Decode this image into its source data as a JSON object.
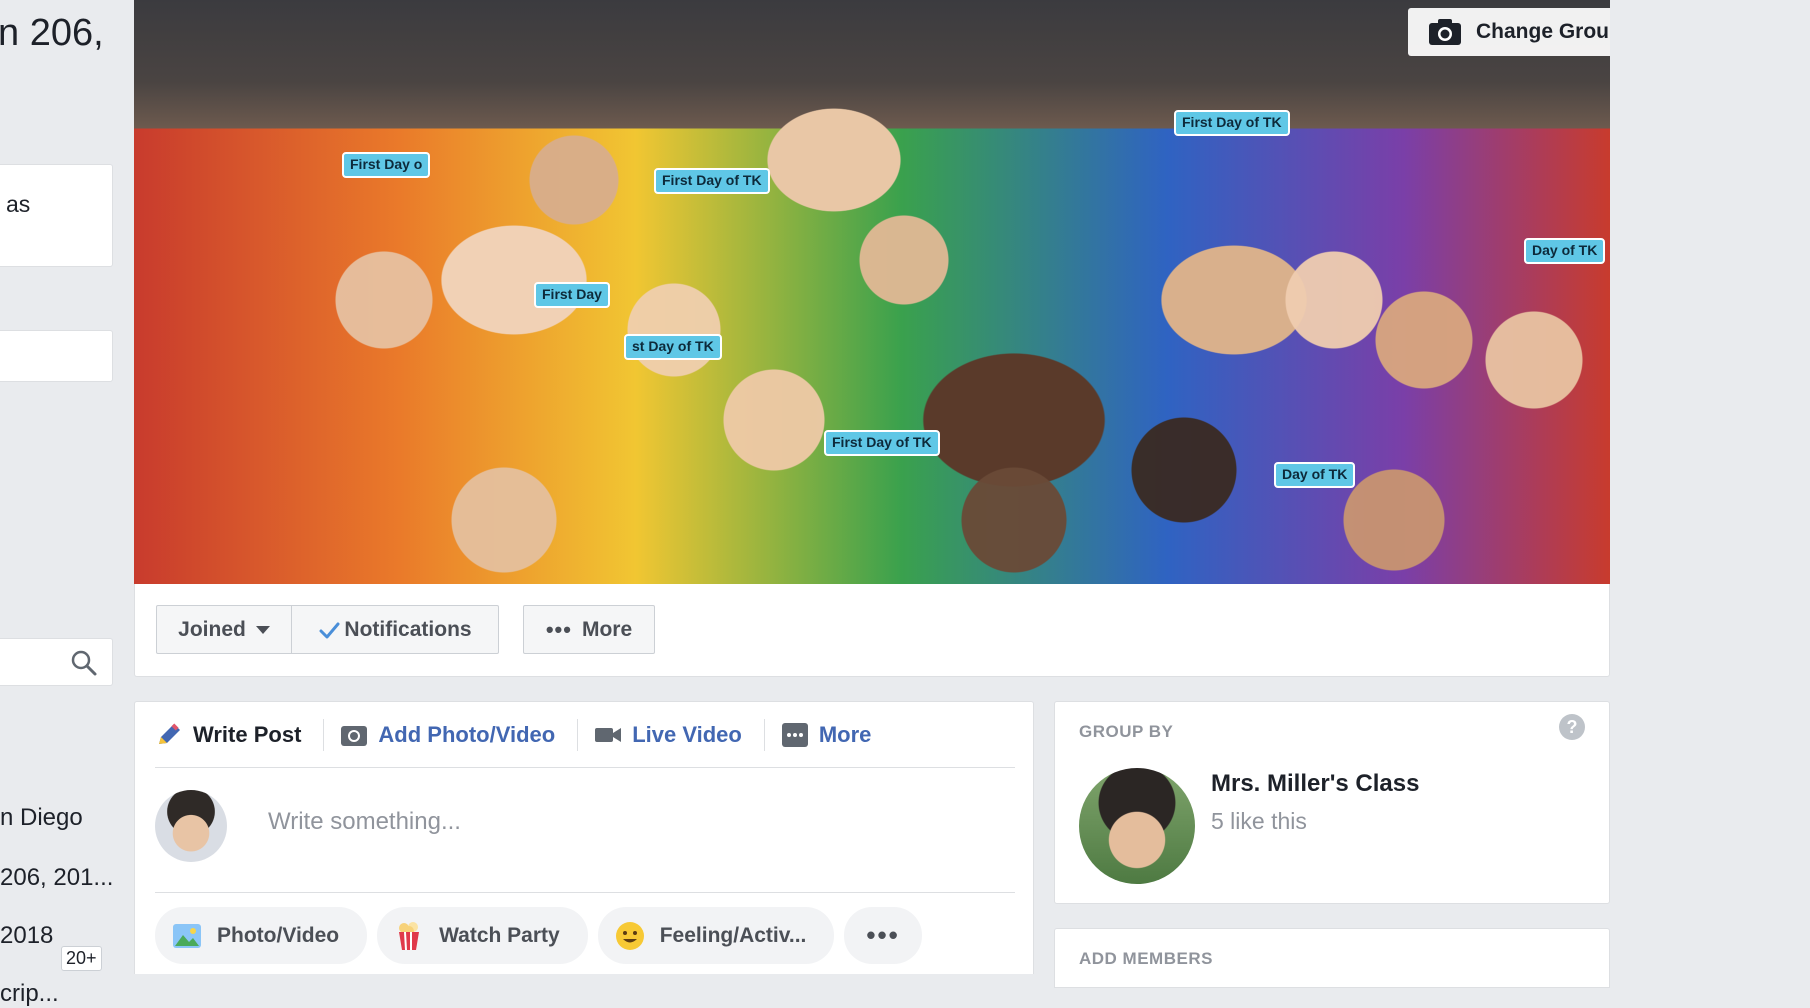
{
  "sidebar": {
    "title_fragment": "n 206,",
    "box_text_fragment": "as",
    "lines": [
      "n Diego",
      "206, 201...",
      "2018",
      "crip..."
    ],
    "badge": "20+"
  },
  "cover": {
    "change_cover_label": "Change Group Cover",
    "hat_texts": [
      "First Day o",
      "First Day of TK",
      "First Day of TK",
      "Day of TK",
      "First Day",
      "st Day of TK",
      "First Day of TK",
      "Day of TK"
    ]
  },
  "actions": {
    "joined_label": "Joined",
    "notifications_label": "Notifications",
    "more_label": "More"
  },
  "composer": {
    "tabs": [
      "Write Post",
      "Add Photo/Video",
      "Live Video",
      "More"
    ],
    "placeholder": "Write something...",
    "pills": [
      "Photo/Video",
      "Watch Party",
      "Feeling/Activ...",
      "•••"
    ]
  },
  "group_by": {
    "heading": "GROUP BY",
    "help": "?",
    "name": "Mrs. Miller's Class",
    "likes": "5 like this"
  },
  "add_members": {
    "heading": "ADD MEMBERS"
  }
}
